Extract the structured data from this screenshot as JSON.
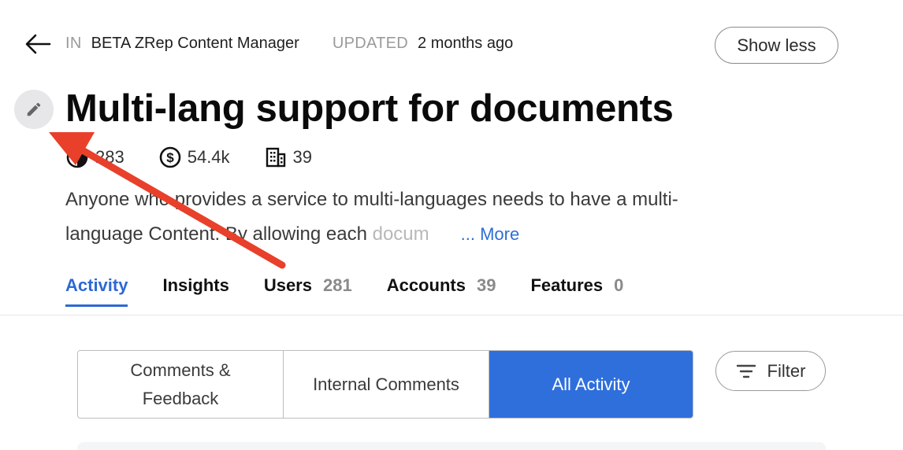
{
  "header": {
    "in_label": "IN",
    "product": "BETA ZRep Content Manager",
    "updated_label": "UPDATED",
    "updated_value": "2 months ago",
    "show_less_label": "Show less"
  },
  "title": "Multi-lang support for documents",
  "stats": {
    "votes": "283",
    "revenue": "54.4k",
    "accounts": "39"
  },
  "description": {
    "line1": "Anyone who provides a service to multi-languages needs to have a multi-",
    "line2_a": "language Content. By allowing each ",
    "line2_b": "docum",
    "more_label": "... More"
  },
  "tabs": [
    {
      "label": "Activity",
      "count": ""
    },
    {
      "label": "Insights",
      "count": ""
    },
    {
      "label": "Users",
      "count": "281"
    },
    {
      "label": "Accounts",
      "count": "39"
    },
    {
      "label": "Features",
      "count": "0"
    }
  ],
  "activity_filter": {
    "segments": [
      "Comments &",
      "Feedback",
      "Internal Comments",
      "All Activity"
    ],
    "selected": "All Activity",
    "filter_label": "Filter"
  },
  "colors": {
    "accent": "#2f6fdc",
    "arrow": "#e8402a"
  }
}
